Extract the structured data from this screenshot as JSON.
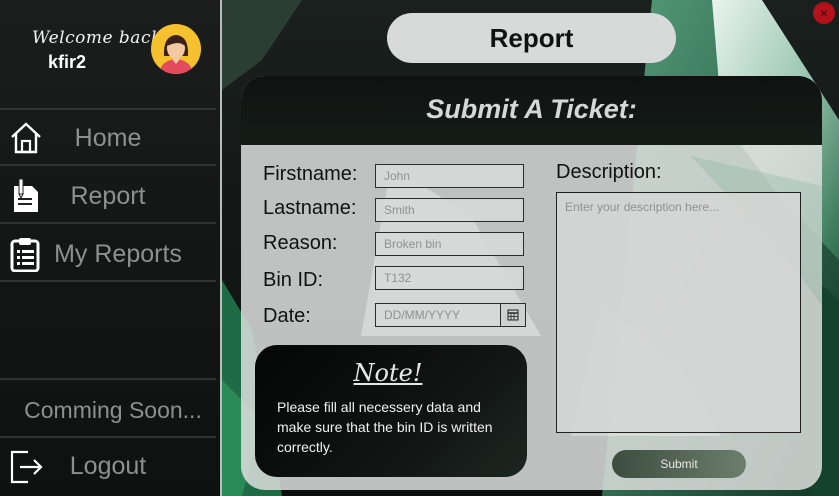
{
  "sidebar": {
    "welcome": "Welcome back,",
    "username": "kfir2",
    "items": [
      {
        "label": "Home",
        "icon": "home-icon"
      },
      {
        "label": "Report",
        "icon": "document-pen-icon"
      },
      {
        "label": "My Reports",
        "icon": "clipboard-icon"
      }
    ],
    "coming_soon": "Comming Soon...",
    "logout": {
      "label": "Logout",
      "icon": "logout-icon"
    }
  },
  "header": {
    "title": "Report",
    "close_icon": "close-icon",
    "close_glyph": "×"
  },
  "form": {
    "title": "Submit A Ticket:",
    "fields": {
      "firstname": {
        "label": "Firstname:",
        "placeholder": "John"
      },
      "lastname": {
        "label": "Lastname:",
        "placeholder": "Smith"
      },
      "reason": {
        "label": "Reason:",
        "placeholder": "Broken bin"
      },
      "bin_id": {
        "label": "Bin ID:",
        "placeholder": "T132"
      },
      "date": {
        "label": "Date:",
        "placeholder": "DD/MM/YYYY",
        "picker_icon": "calendar-icon"
      }
    },
    "description": {
      "label": "Description:",
      "placeholder": "Enter your description here..."
    },
    "submit_label": "Submit"
  },
  "note": {
    "title": "Note!",
    "text": "Please fill all necessery data and make sure that the bin ID is written correctly."
  },
  "colors": {
    "accent_red": "#b3121b",
    "avatar_bg": "#f5c12f",
    "submit_green": "#56685a"
  }
}
